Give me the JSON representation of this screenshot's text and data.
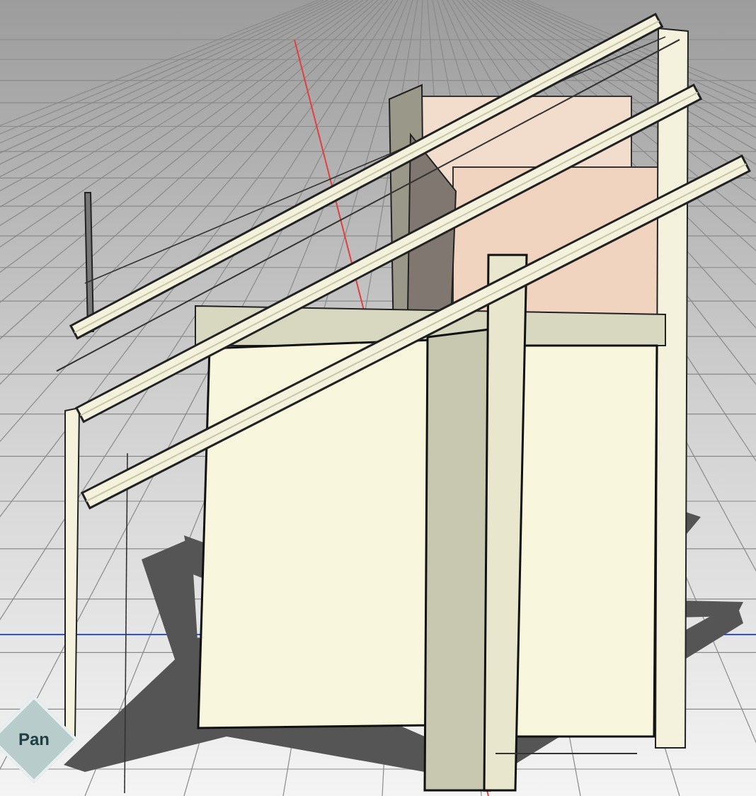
{
  "nav_widget": {
    "label": "Pan"
  }
}
